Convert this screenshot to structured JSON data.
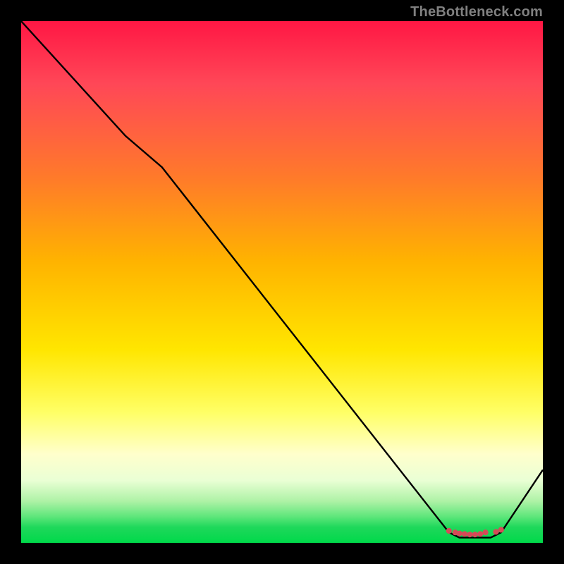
{
  "watermark": "TheBottleneck.com",
  "colors": {
    "line": "#000000",
    "scatter": "#d64a57",
    "top": "#ff1744",
    "bottom": "#00d94a",
    "bg": "#000000"
  },
  "chart_data": {
    "type": "line",
    "title": "",
    "xlabel": "",
    "ylabel": "",
    "xlim": [
      0,
      100
    ],
    "ylim": [
      0,
      100
    ],
    "grid": false,
    "legend": false,
    "line_points": [
      {
        "x": 0,
        "y": 100
      },
      {
        "x": 20,
        "y": 78
      },
      {
        "x": 27,
        "y": 72
      },
      {
        "x": 82,
        "y": 2
      },
      {
        "x": 84,
        "y": 1
      },
      {
        "x": 90,
        "y": 1
      },
      {
        "x": 92,
        "y": 2
      },
      {
        "x": 100,
        "y": 14
      }
    ],
    "scatter_points": [
      {
        "x": 82.0,
        "y": 2.3
      },
      {
        "x": 83.2,
        "y": 2.0
      },
      {
        "x": 84.0,
        "y": 1.8
      },
      {
        "x": 85.0,
        "y": 1.7
      },
      {
        "x": 86.0,
        "y": 1.6
      },
      {
        "x": 87.0,
        "y": 1.6
      },
      {
        "x": 88.0,
        "y": 1.7
      },
      {
        "x": 89.0,
        "y": 2.0
      },
      {
        "x": 91.0,
        "y": 2.1
      },
      {
        "x": 92.0,
        "y": 2.5
      }
    ]
  }
}
